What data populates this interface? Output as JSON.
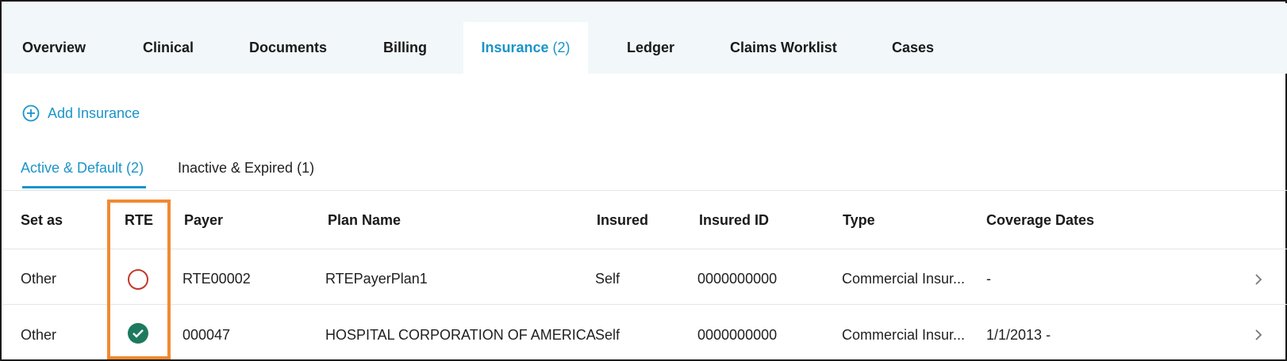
{
  "top_tabs": [
    {
      "label": "Overview"
    },
    {
      "label": "Clinical"
    },
    {
      "label": "Documents"
    },
    {
      "label": "Billing"
    },
    {
      "label": "Insurance",
      "count": "(2)",
      "active": true
    },
    {
      "label": "Ledger"
    },
    {
      "label": "Claims Worklist"
    },
    {
      "label": "Cases"
    }
  ],
  "add_insurance": {
    "label": "Add Insurance",
    "icon": "plus-circle-icon"
  },
  "sub_tabs": [
    {
      "label": "Active & Default (2)",
      "active": true
    },
    {
      "label": "Inactive & Expired (1)"
    }
  ],
  "table": {
    "headers": [
      "Set as",
      "RTE",
      "Payer",
      "Plan Name",
      "Insured",
      "Insured ID",
      "Type",
      "Coverage Dates"
    ],
    "rows": [
      {
        "set_as": "Other",
        "rte": "not-verified",
        "payer": "RTE00002",
        "plan_name": "RTEPayerPlan1",
        "insured": "Self",
        "insured_id": "0000000000",
        "type": "Commercial Insur...",
        "coverage_dates": "-"
      },
      {
        "set_as": "Other",
        "rte": "verified",
        "payer": "000047",
        "plan_name": "HOSPITAL CORPORATION OF AMERICA",
        "insured": "Self",
        "insured_id": "0000000000",
        "type": "Commercial Insur...",
        "coverage_dates": "1/1/2013 -"
      }
    ]
  },
  "colors": {
    "accent": "#1b94c9",
    "highlight": "#f08a32",
    "rte_ok": "#1c7a5e",
    "rte_empty": "#c0392b"
  }
}
